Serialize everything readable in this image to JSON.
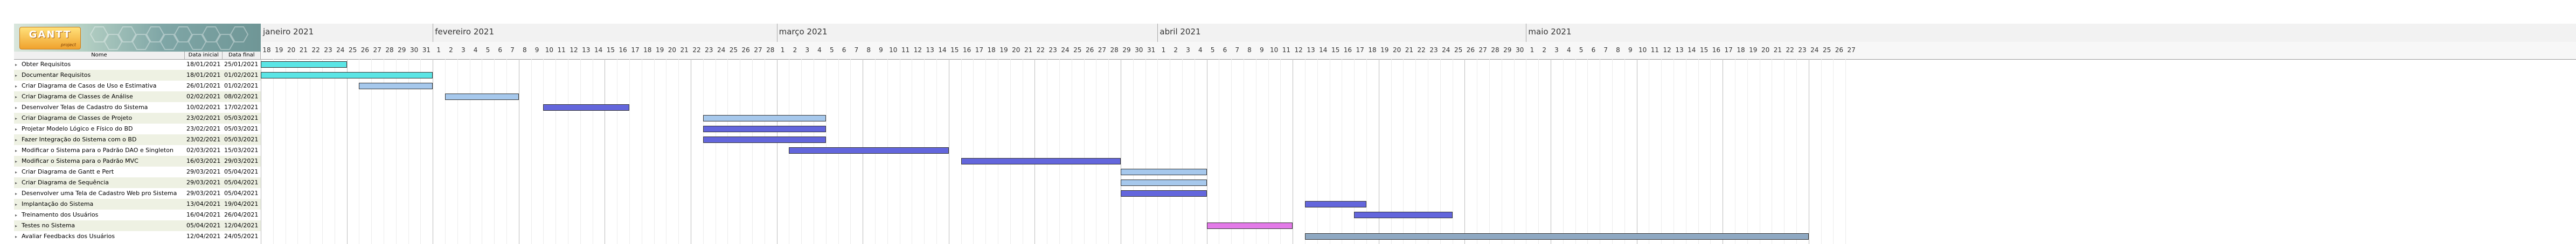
{
  "columns": {
    "name": "Nome",
    "start": "Data inicial",
    "end": "Data final"
  },
  "logo": {
    "text": "GANTT",
    "subtitle": "project"
  },
  "timeline": {
    "first_day": "2021-01-18",
    "months": [
      {
        "label": "janeiro 2021",
        "start": "2021-01-18"
      },
      {
        "label": "fevereiro 2021",
        "start": "2021-02-01"
      },
      {
        "label": "março 2021",
        "start": "2021-03-01"
      },
      {
        "label": "abril 2021",
        "start": "2021-04-01"
      },
      {
        "label": "maio 2021",
        "start": "2021-05-01"
      }
    ],
    "day_numbers": [
      18,
      19,
      20,
      21,
      22,
      23,
      24,
      25,
      26,
      27,
      28,
      29,
      30,
      31,
      1,
      2,
      3,
      4,
      5,
      6,
      7,
      8,
      9,
      10,
      11,
      12,
      13,
      14,
      15,
      16,
      17,
      18,
      19,
      20,
      21,
      22,
      23,
      24,
      25,
      26,
      27,
      28,
      1,
      2,
      3,
      4,
      5,
      6,
      7,
      8,
      9,
      10,
      11,
      12,
      13,
      14,
      15,
      16,
      17,
      18,
      19,
      20,
      21,
      22,
      23,
      24,
      25,
      26,
      27,
      28,
      29,
      30,
      31,
      1,
      2,
      3,
      4,
      5,
      6,
      7,
      8,
      9,
      10,
      11,
      12,
      13,
      14,
      15,
      16,
      17,
      18,
      19,
      20,
      21,
      22,
      23,
      24,
      25,
      26,
      27,
      28,
      29,
      30,
      1,
      2,
      3,
      4,
      5,
      6,
      7,
      8,
      9,
      10,
      11,
      12,
      13,
      14,
      15,
      16,
      17,
      18,
      19,
      20,
      21,
      22,
      23,
      24,
      25,
      26,
      27
    ],
    "week_start_offsets": [
      0,
      7,
      14,
      21,
      28,
      35,
      42,
      49,
      56,
      63,
      70,
      77,
      84,
      91,
      98,
      105,
      112,
      119,
      126
    ]
  },
  "colors": {
    "cyan": "#5be5e5",
    "light_blue": "#a6c8ec",
    "dark_blue": "#6366dc",
    "magenta": "#e37ae8",
    "steel": "#8ea8c2"
  },
  "tasks": [
    {
      "name": "Obter Requisitos",
      "start": "18/01/2021",
      "end": "25/01/2021",
      "bar_start": "2021-01-18",
      "bar_end": "2021-01-25",
      "color": "#5be5e5"
    },
    {
      "name": "Documentar Requisitos",
      "start": "18/01/2021",
      "end": "01/02/2021",
      "bar_start": "2021-01-18",
      "bar_end": "2021-02-01",
      "color": "#5be5e5"
    },
    {
      "name": "Criar Diagrama de Casos de Uso e Estimativa",
      "start": "26/01/2021",
      "end": "01/02/2021",
      "bar_start": "2021-01-26",
      "bar_end": "2021-02-01",
      "color": "#a6c8ec"
    },
    {
      "name": "Criar Diagrama de Classes de Análise",
      "start": "02/02/2021",
      "end": "08/02/2021",
      "bar_start": "2021-02-02",
      "bar_end": "2021-02-08",
      "color": "#a6c8ec"
    },
    {
      "name": "Desenvolver Telas de Cadastro do Sistema",
      "start": "10/02/2021",
      "end": "17/02/2021",
      "bar_start": "2021-02-10",
      "bar_end": "2021-02-17",
      "color": "#6366dc"
    },
    {
      "name": "Criar Diagrama de Classes de Projeto",
      "start": "23/02/2021",
      "end": "05/03/2021",
      "bar_start": "2021-02-23",
      "bar_end": "2021-03-05",
      "color": "#a6c8ec"
    },
    {
      "name": "Projetar Modelo Lógico e Físico do BD",
      "start": "23/02/2021",
      "end": "05/03/2021",
      "bar_start": "2021-02-23",
      "bar_end": "2021-03-05",
      "color": "#6366dc"
    },
    {
      "name": "Fazer Integração do Sistema com o BD",
      "start": "23/02/2021",
      "end": "05/03/2021",
      "bar_start": "2021-02-23",
      "bar_end": "2021-03-05",
      "color": "#6366dc"
    },
    {
      "name": "Modificar o Sistema para o Padrão DAO e Singleton",
      "start": "02/03/2021",
      "end": "15/03/2021",
      "bar_start": "2021-03-02",
      "bar_end": "2021-03-15",
      "color": "#6366dc"
    },
    {
      "name": "Modificar o Sistema para o Padrão MVC",
      "start": "16/03/2021",
      "end": "29/03/2021",
      "bar_start": "2021-03-16",
      "bar_end": "2021-03-29",
      "color": "#6366dc"
    },
    {
      "name": "Criar Diagrama de Gantt e Pert",
      "start": "29/03/2021",
      "end": "05/04/2021",
      "bar_start": "2021-03-29",
      "bar_end": "2021-04-05",
      "color": "#a6c8ec"
    },
    {
      "name": "Criar Diagrama de Sequência",
      "start": "29/03/2021",
      "end": "05/04/2021",
      "bar_start": "2021-03-29",
      "bar_end": "2021-04-05",
      "color": "#a6c8ec"
    },
    {
      "name": "Desenvolver uma Tela de Cadastro Web pro Sistema",
      "start": "29/03/2021",
      "end": "05/04/2021",
      "bar_start": "2021-03-29",
      "bar_end": "2021-04-05",
      "color": "#6366dc"
    },
    {
      "name": "Implantação do Sistema",
      "start": "13/04/2021",
      "end": "19/04/2021",
      "bar_start": "2021-04-13",
      "bar_end": "2021-04-18",
      "color": "#6366dc"
    },
    {
      "name": "Treinamento dos Usuários",
      "start": "16/04/2021",
      "end": "26/04/2021",
      "bar_start": "2021-04-17",
      "bar_end": "2021-04-25",
      "color": "#6366dc"
    },
    {
      "name": "Testes no Sistema",
      "start": "05/04/2021",
      "end": "12/04/2021",
      "bar_start": "2021-04-05",
      "bar_end": "2021-04-12",
      "color": "#e37ae8"
    },
    {
      "name": "Avaliar Feedbacks dos Usuários",
      "start": "12/04/2021",
      "end": "24/05/2021",
      "bar_start": "2021-04-13",
      "bar_end": "2021-05-24",
      "color": "#8ea8c2"
    }
  ]
}
